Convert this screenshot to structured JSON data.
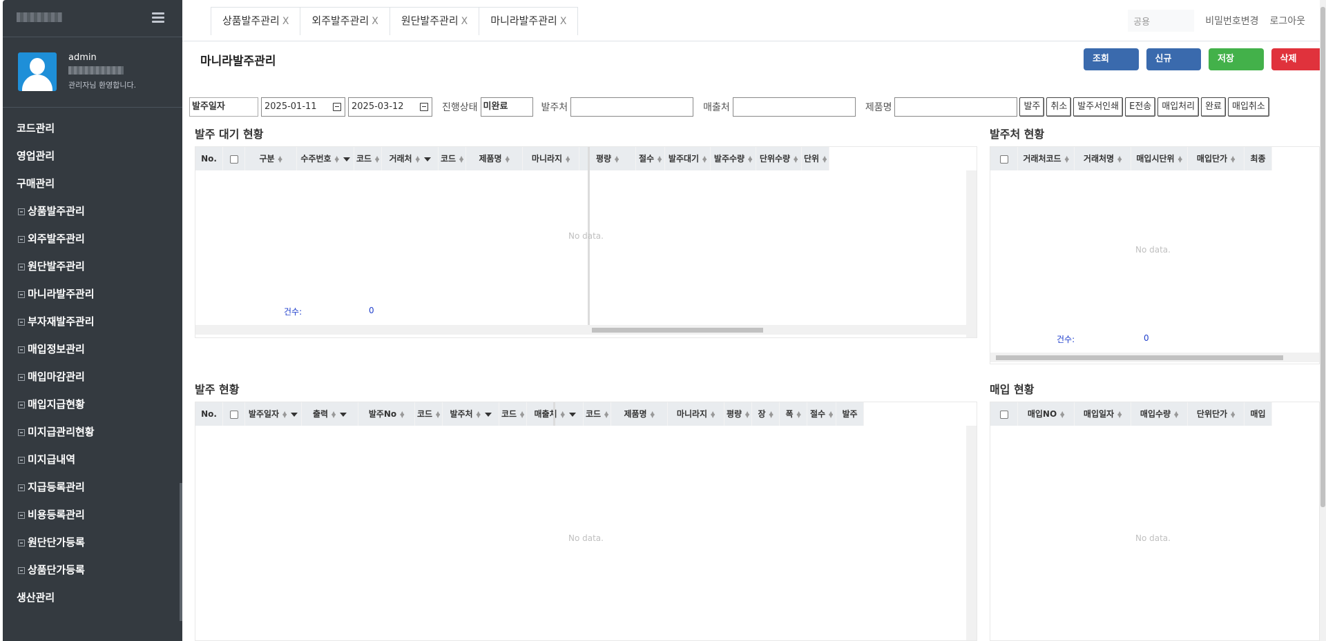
{
  "sidebar": {
    "user": {
      "name": "admin",
      "welcome": "관리자님 환영합니다."
    },
    "menu": [
      {
        "label": "코드관리",
        "sub": false
      },
      {
        "label": "영업관리",
        "sub": false
      },
      {
        "label": "구매관리",
        "sub": false
      },
      {
        "label": "상품발주관리",
        "sub": true
      },
      {
        "label": "외주발주관리",
        "sub": true
      },
      {
        "label": "원단발주관리",
        "sub": true
      },
      {
        "label": "마니라발주관리",
        "sub": true
      },
      {
        "label": "부자재발주관리",
        "sub": true
      },
      {
        "label": "매입정보관리",
        "sub": true
      },
      {
        "label": "매입마감관리",
        "sub": true
      },
      {
        "label": "매입지급현황",
        "sub": true
      },
      {
        "label": "미지급관리현황",
        "sub": true
      },
      {
        "label": "미지급내역",
        "sub": true
      },
      {
        "label": "지급등록관리",
        "sub": true
      },
      {
        "label": "비용등록관리",
        "sub": true
      },
      {
        "label": "원단단가등록",
        "sub": true
      },
      {
        "label": "상품단가등록",
        "sub": true
      },
      {
        "label": "생산관리",
        "sub": false
      }
    ]
  },
  "header": {
    "tabs": [
      {
        "label": "상품발주관리",
        "close": "X"
      },
      {
        "label": "외주발주관리",
        "close": "X"
      },
      {
        "label": "원단발주관리",
        "close": "X"
      },
      {
        "label": "마니라발주관리",
        "close": "X"
      }
    ],
    "search_value": "공용",
    "change_password": "비밀번호변경",
    "logout": "로그아웃"
  },
  "page": {
    "title": "마니라발주관리",
    "actions": {
      "search": "조회(F3)",
      "new": "신규(F2)",
      "save": "저장(F4)",
      "delete": "삭제(F8)"
    }
  },
  "filters": {
    "date_type": "발주일자",
    "date_from": "2025-01-11",
    "date_to": "2025-03-12",
    "status_label": "진행상태",
    "status_value": "미완료",
    "vendor_label": "발주처",
    "seller_label": "매출처",
    "product_label": "제품명",
    "buttons": [
      "발주",
      "취소",
      "발주서인쇄",
      "E전송",
      "매입처리",
      "완료",
      "매입취소"
    ]
  },
  "sections": {
    "pending": {
      "title": "발주 대기 현황",
      "columns": [
        "No.",
        "",
        "구분",
        "수주번호",
        "코드",
        "거래처",
        "코드",
        "제품명",
        "마니라지",
        "평량",
        "절수",
        "발주대기",
        "발주수량",
        "단위수량",
        "단위"
      ],
      "no_data": "No data.",
      "count_label": "건수:",
      "count": "0"
    },
    "vendor": {
      "title": "발주처 현황",
      "columns": [
        "",
        "거래처코드",
        "거래처명",
        "매입시단위",
        "매입단가",
        "최종"
      ],
      "no_data": "No data.",
      "count_label": "건수:",
      "count": "0"
    },
    "orders": {
      "title": "발주 현황",
      "columns": [
        "No.",
        "",
        "발주일자",
        "출력",
        "발주No",
        "코드",
        "발주처",
        "코드",
        "매출처",
        "코드",
        "제품명",
        "마니라지",
        "평량",
        "장",
        "폭",
        "절수",
        "발주"
      ],
      "no_data": "No data."
    },
    "purchase": {
      "title": "매입 현황",
      "columns": [
        "",
        "매입NO",
        "매입일자",
        "매입수량",
        "단위단가",
        "매입"
      ],
      "no_data": "No data."
    }
  }
}
